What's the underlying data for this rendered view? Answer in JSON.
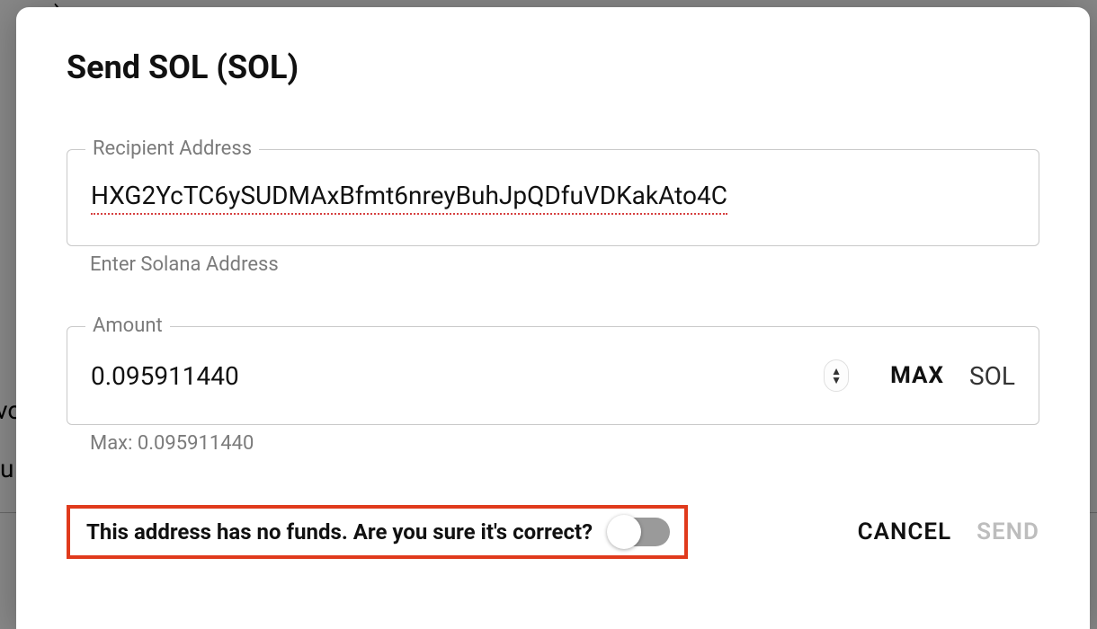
{
  "backdrop": {
    "t1": ")",
    "t2": "vo",
    "t3": "u"
  },
  "modal": {
    "title": "Send SOL (SOL)"
  },
  "recipient": {
    "legend": "Recipient Address",
    "value": "HXG2YcTC6ySUDMAxBfmt6nreyBuhJpQDfuVDKakAto4C",
    "help": "Enter Solana Address"
  },
  "amount": {
    "legend": "Amount",
    "value": "0.095911440",
    "max_button": "MAX",
    "unit": "SOL",
    "help": "Max: 0.095911440"
  },
  "warning": {
    "text": "This address has no funds. Are you sure it's correct?"
  },
  "footer": {
    "cancel": "CANCEL",
    "send": "SEND"
  }
}
